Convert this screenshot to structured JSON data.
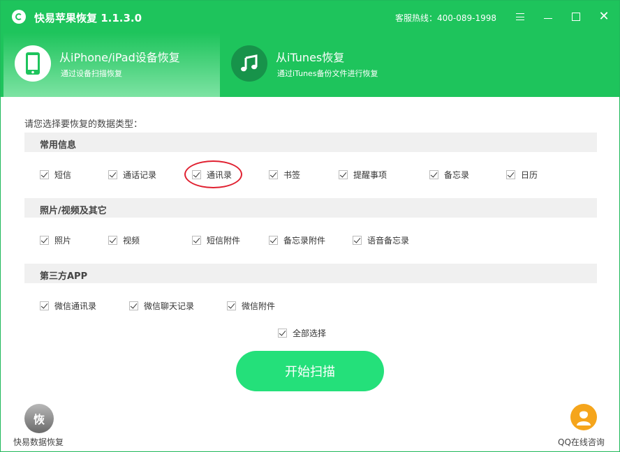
{
  "titlebar": {
    "title": "快易苹果恢复 1.1.3.0",
    "hotline": "客服热线：400-089-1998",
    "icons": {
      "logo": "recover-logo-icon",
      "menu": "menu-icon",
      "min": "minimize-icon",
      "max": "maximize-icon",
      "close": "close-icon"
    }
  },
  "modes": [
    {
      "title": "从iPhone/iPad设备恢复",
      "sub": "通过设备扫描恢复",
      "icon": "phone-icon",
      "active": true
    },
    {
      "title": "从iTunes恢复",
      "sub": "通过iTunes备份文件进行恢复",
      "icon": "music-note-icon",
      "active": false
    }
  ],
  "prompt": "请您选择要恢复的数据类型：",
  "sections": [
    {
      "title": "常用信息",
      "items": [
        "短信",
        "通话记录",
        "通讯录",
        "书签",
        "提醒事项",
        "备忘录",
        "日历"
      ]
    },
    {
      "title": "照片/视频及其它",
      "items": [
        "照片",
        "视频",
        "短信附件",
        "备忘录附件",
        "语音备忘录"
      ]
    },
    {
      "title": "第三方APP",
      "items": [
        "微信通讯录",
        "微信聊天记录",
        "微信附件"
      ]
    }
  ],
  "select_all": "全部选择",
  "scan_button": "开始扫描",
  "footer": {
    "left_logo_glyph": "恢",
    "left_label": "快易数据恢复",
    "right_label": "QQ在线咨询"
  },
  "colors": {
    "brand_green": "#1ec45c",
    "button_green": "#24e07a",
    "highlight_red": "#e02030",
    "qq_orange": "#f5a51c"
  }
}
